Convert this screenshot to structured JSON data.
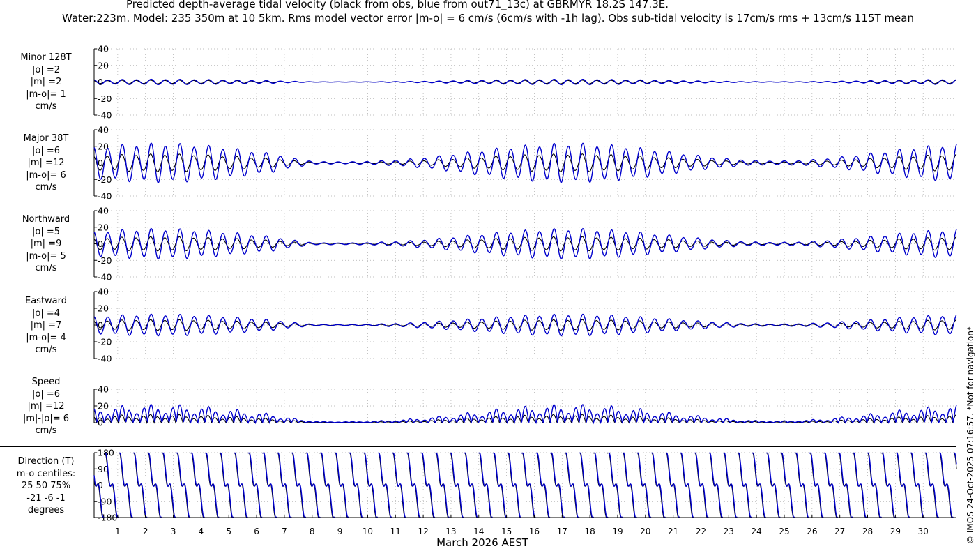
{
  "header": {
    "line1": "Predicted depth-average tidal velocity (black from obs, blue from out71_13c) at GBRMYR 18.2S 147.3E.",
    "line2": "Water:223m. Model: 235 350m at 10 5km. Rms model vector error |m-o| = 6 cm/s (6cm/s with -1h lag). Obs sub-tidal velocity is 17cm/s rms + 13cm/s 115T mean"
  },
  "copyright": "© IMOS 24-Oct-2025 07:16:57. *Not for navigation*",
  "colors": {
    "obs": "#000000",
    "model": "#0000cc",
    "grid": "#aaaaaa"
  },
  "chart_data": [
    {
      "type": "line",
      "name": "minor",
      "labels": [
        "Minor 128T",
        "|o| =2",
        "|m| =2",
        "|m-o|= 1",
        "cm/s"
      ],
      "ylim": [
        -40,
        40
      ],
      "yticks": [
        -40,
        -20,
        0,
        20,
        40
      ],
      "series": [
        {
          "name": "obs",
          "amplitude": 2
        },
        {
          "name": "model",
          "amplitude": 3
        }
      ]
    },
    {
      "type": "line",
      "name": "major",
      "labels": [
        "Major 38T",
        "|o| =6",
        "|m| =12",
        "|m-o|= 6",
        "cm/s"
      ],
      "ylim": [
        -40,
        40
      ],
      "yticks": [
        -40,
        -20,
        0,
        20,
        40
      ],
      "series": [
        {
          "name": "obs",
          "amplitude": 10
        },
        {
          "name": "model",
          "amplitude": 22
        }
      ]
    },
    {
      "type": "line",
      "name": "northward",
      "labels": [
        "Northward",
        "|o| =5",
        "|m| =9",
        "|m-o|= 5",
        "cm/s"
      ],
      "ylim": [
        -40,
        40
      ],
      "yticks": [
        -40,
        -20,
        0,
        20,
        40
      ],
      "series": [
        {
          "name": "obs",
          "amplitude": 8
        },
        {
          "name": "model",
          "amplitude": 17
        }
      ]
    },
    {
      "type": "line",
      "name": "eastward",
      "labels": [
        "Eastward",
        "|o| =4",
        "|m| =7",
        "|m-o|= 4",
        "cm/s"
      ],
      "ylim": [
        -40,
        40
      ],
      "yticks": [
        -40,
        -20,
        0,
        20,
        40
      ],
      "series": [
        {
          "name": "obs",
          "amplitude": 6
        },
        {
          "name": "model",
          "amplitude": 12
        }
      ]
    },
    {
      "type": "line",
      "name": "speed",
      "labels": [
        "Speed",
        "|o| =6",
        "|m| =12",
        "|m|-|o|= 6",
        "cm/s"
      ],
      "ylim": [
        0,
        40
      ],
      "yticks": [
        0,
        20,
        40
      ],
      "series": [
        {
          "name": "obs",
          "amplitude": 10
        },
        {
          "name": "model",
          "amplitude": 22
        }
      ]
    },
    {
      "type": "line",
      "name": "direction",
      "labels": [
        "Direction (T)",
        "m-o centiles:",
        "25  50  75%",
        "-21  -6  -1",
        "degrees"
      ],
      "ylim": [
        -180,
        180
      ],
      "yticks": [
        -180,
        -90,
        0,
        90,
        180
      ],
      "series": [
        {
          "name": "obs"
        },
        {
          "name": "model"
        }
      ]
    }
  ],
  "xaxis": {
    "label": "March 2026 AEST",
    "days": [
      1,
      2,
      3,
      4,
      5,
      6,
      7,
      8,
      9,
      10,
      11,
      12,
      13,
      14,
      15,
      16,
      17,
      18,
      19,
      20,
      21,
      22,
      23,
      24,
      25,
      26,
      27,
      28,
      29,
      30
    ]
  }
}
